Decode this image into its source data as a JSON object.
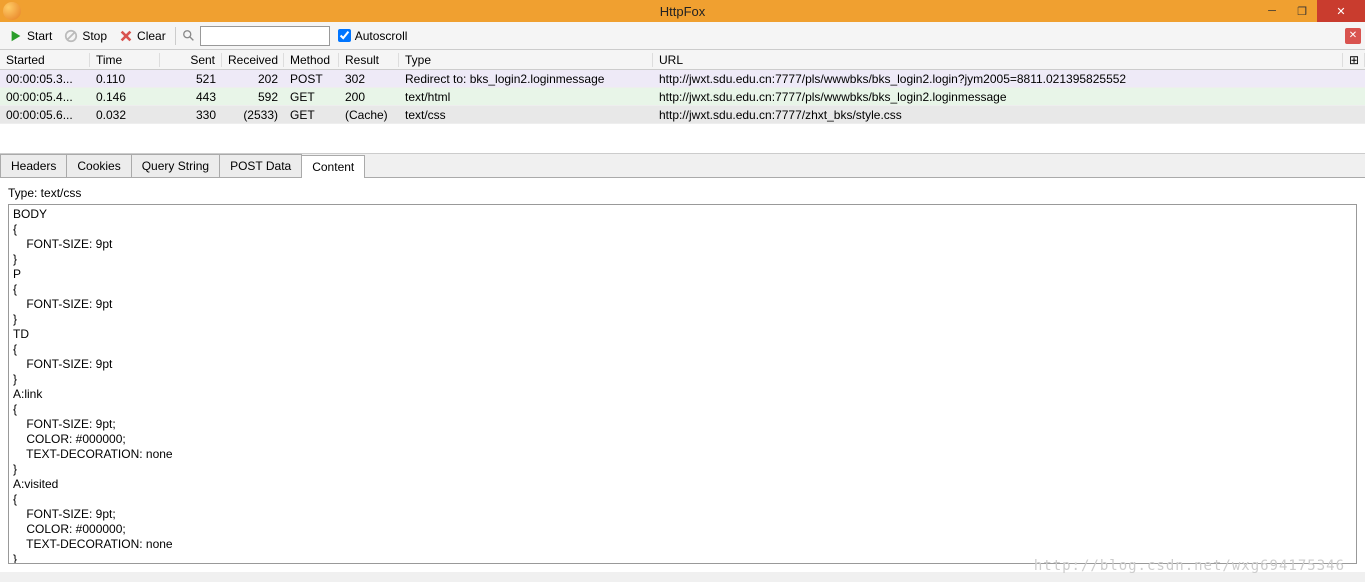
{
  "window": {
    "title": "HttpFox"
  },
  "toolbar": {
    "start": "Start",
    "stop": "Stop",
    "clear": "Clear",
    "autoscroll": "Autoscroll",
    "search_placeholder": ""
  },
  "grid": {
    "headers": {
      "started": "Started",
      "time": "Time",
      "sent": "Sent",
      "received": "Received",
      "method": "Method",
      "result": "Result",
      "type": "Type",
      "url": "URL"
    },
    "rows": [
      {
        "started": "00:00:05.3...",
        "time": "0.110",
        "sent": "521",
        "received": "202",
        "method": "POST",
        "result": "302",
        "type": "Redirect to: bks_login2.loginmessage",
        "url": "http://jwxt.sdu.edu.cn:7777/pls/wwwbks/bks_login2.login?jym2005=8811.021395825552"
      },
      {
        "started": "00:00:05.4...",
        "time": "0.146",
        "sent": "443",
        "received": "592",
        "method": "GET",
        "result": "200",
        "type": "text/html",
        "url": "http://jwxt.sdu.edu.cn:7777/pls/wwwbks/bks_login2.loginmessage"
      },
      {
        "started": "00:00:05.6...",
        "time": "0.032",
        "sent": "330",
        "received": "(2533)",
        "method": "GET",
        "result": "(Cache)",
        "type": "text/css",
        "url": "http://jwxt.sdu.edu.cn:7777/zhxt_bks/style.css"
      }
    ]
  },
  "tabs": {
    "items": [
      "Headers",
      "Cookies",
      "Query String",
      "POST Data",
      "Content"
    ],
    "active": 4
  },
  "content": {
    "type_label": "Type: text/css",
    "body": "BODY\n{\n    FONT-SIZE: 9pt\n}\nP\n{\n    FONT-SIZE: 9pt\n}\nTD\n{\n    FONT-SIZE: 9pt\n}\nA:link\n{\n    FONT-SIZE: 9pt;\n    COLOR: #000000;\n    TEXT-DECORATION: none\n}\nA:visited\n{\n    FONT-SIZE: 9pt;\n    COLOR: #000000;\n    TEXT-DECORATION: none\n}"
  },
  "watermark": "http://blog.csdn.net/wxg694175346"
}
